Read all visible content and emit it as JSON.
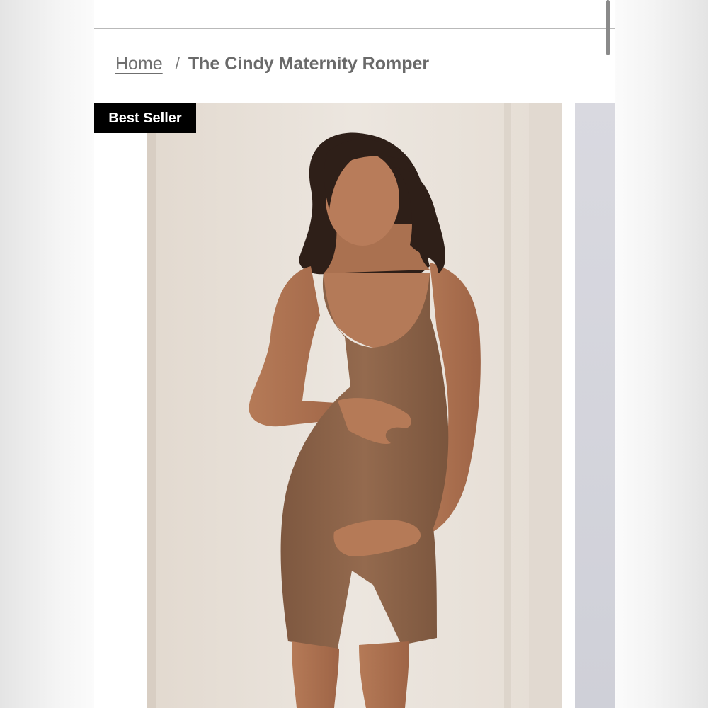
{
  "breadcrumb": {
    "home_label": "Home",
    "separator": "/",
    "current_label": "The Cindy Maternity Romper"
  },
  "product": {
    "badge": "Best Seller",
    "image_icon": "product-photo",
    "colors": {
      "romper": "#8a6247",
      "wall": "#e9e2da",
      "badge_bg": "#000000"
    }
  }
}
